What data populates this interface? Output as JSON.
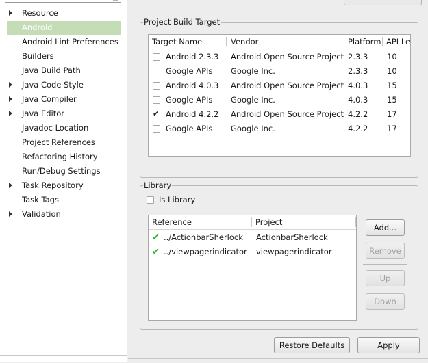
{
  "tree": {
    "items": [
      {
        "label": "Resource",
        "arrow": true
      },
      {
        "label": "Android",
        "arrow": false,
        "selected": true
      },
      {
        "label": "Android Lint Preferences",
        "arrow": false
      },
      {
        "label": "Builders",
        "arrow": false
      },
      {
        "label": "Java Build Path",
        "arrow": false
      },
      {
        "label": "Java Code Style",
        "arrow": true
      },
      {
        "label": "Java Compiler",
        "arrow": true
      },
      {
        "label": "Java Editor",
        "arrow": true
      },
      {
        "label": "Javadoc Location",
        "arrow": false
      },
      {
        "label": "Project References",
        "arrow": false
      },
      {
        "label": "Refactoring History",
        "arrow": false
      },
      {
        "label": "Run/Debug Settings",
        "arrow": false
      },
      {
        "label": "Task Repository",
        "arrow": true
      },
      {
        "label": "Task Tags",
        "arrow": false
      },
      {
        "label": "Validation",
        "arrow": true
      }
    ]
  },
  "build_target": {
    "group_title": "Project Build Target",
    "columns": [
      "Target Name",
      "Vendor",
      "Platform",
      "API Le"
    ],
    "rows": [
      {
        "name": "Android 2.3.3",
        "vendor": "Android Open Source Project",
        "platform": "2.3.3",
        "api": "10",
        "checked": false
      },
      {
        "name": "Google APIs",
        "vendor": "Google Inc.",
        "platform": "2.3.3",
        "api": "10",
        "checked": false
      },
      {
        "name": "Android 4.0.3",
        "vendor": "Android Open Source Project",
        "platform": "4.0.3",
        "api": "15",
        "checked": false
      },
      {
        "name": "Google APIs",
        "vendor": "Google Inc.",
        "platform": "4.0.3",
        "api": "15",
        "checked": false
      },
      {
        "name": "Android 4.2.2",
        "vendor": "Android Open Source Project",
        "platform": "4.2.2",
        "api": "17",
        "checked": true
      },
      {
        "name": "Google APIs",
        "vendor": "Google Inc.",
        "platform": "4.2.2",
        "api": "17",
        "checked": false
      }
    ]
  },
  "library": {
    "group_title": "Library",
    "is_library_label": "Is Library",
    "is_library_checked": false,
    "columns": [
      "Reference",
      "Project"
    ],
    "rows": [
      {
        "reference": "../ActionbarSherlock",
        "project": "ActionbarSherlock"
      },
      {
        "reference": "../viewpagerindicator",
        "project": "viewpagerindicator"
      }
    ],
    "buttons": {
      "add": "Add...",
      "remove": "Remove",
      "up": "Up",
      "down": "Down"
    }
  },
  "footer": {
    "restore_defaults": "Restore Defaults",
    "apply": "Apply"
  },
  "colors": {
    "selection": "#c5ddb7",
    "valid_check": "#2fb52f"
  }
}
